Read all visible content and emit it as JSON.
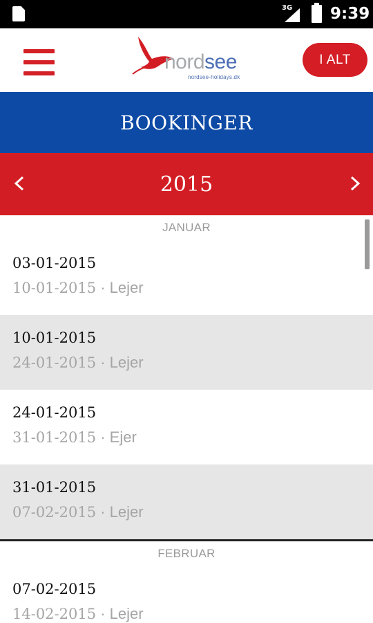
{
  "status_bar": {
    "network": "3G",
    "time": "9:39"
  },
  "app_bar": {
    "logo_main_a": "nord",
    "logo_main_b": "see",
    "logo_sub": "nordsee-holidays.dk",
    "button_label": "I ALT"
  },
  "page_title": "BOOKINGER",
  "year_nav": {
    "year": "2015"
  },
  "colors": {
    "brand_red": "#d31d24",
    "brand_blue": "#0d4aa5",
    "row_gray": "#e7e6e7"
  },
  "months": [
    {
      "name": "JANUAR",
      "bookings": [
        {
          "start": "03-01-2015",
          "end": "10-01-2015",
          "type": "Lejer"
        },
        {
          "start": "10-01-2015",
          "end": "24-01-2015",
          "type": "Lejer"
        },
        {
          "start": "24-01-2015",
          "end": "31-01-2015",
          "type": "Ejer"
        },
        {
          "start": "31-01-2015",
          "end": "07-02-2015",
          "type": "Lejer"
        }
      ]
    },
    {
      "name": "FEBRUAR",
      "bookings": [
        {
          "start": "07-02-2015",
          "end": "14-02-2015",
          "type": "Lejer"
        }
      ]
    }
  ],
  "separator": " · "
}
